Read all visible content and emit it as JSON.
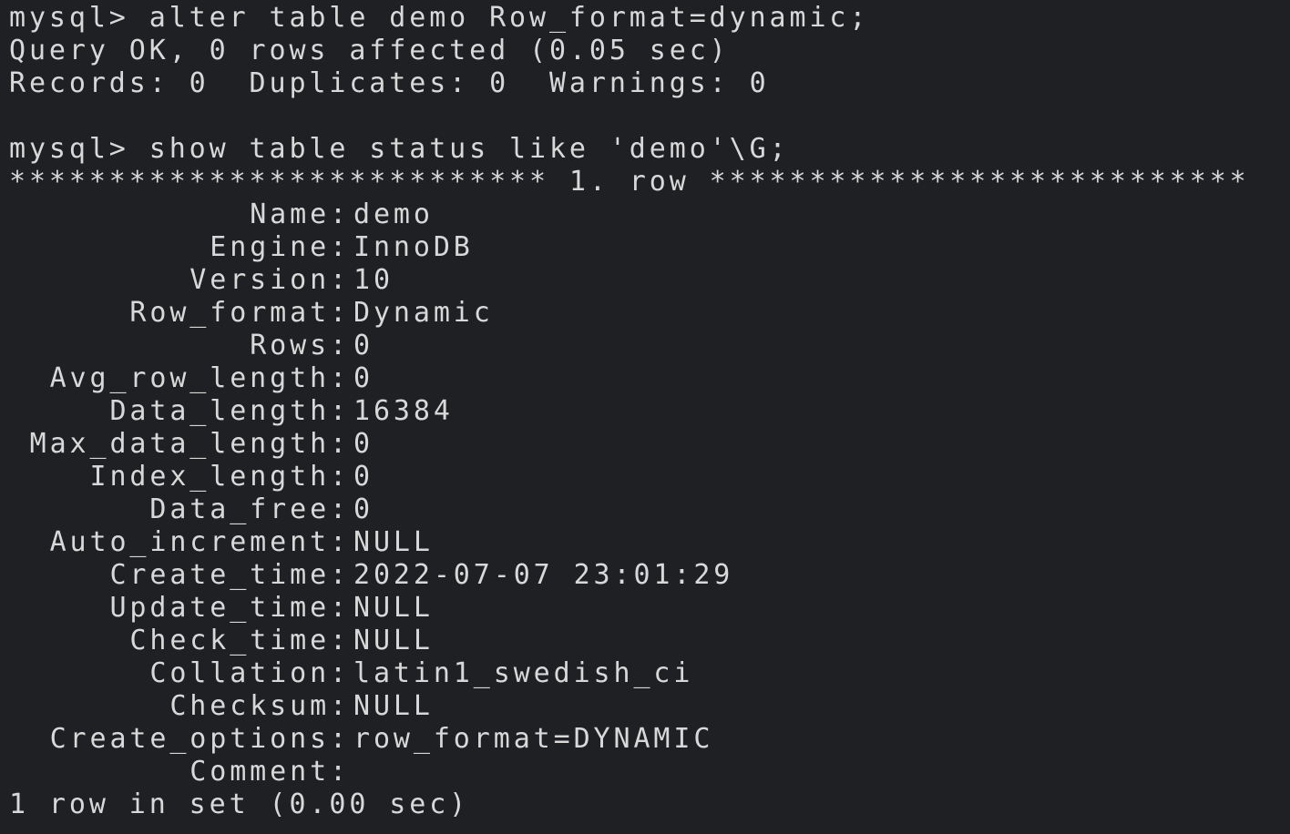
{
  "terminal": {
    "block1": {
      "command": "mysql> alter table demo Row_format=dynamic;",
      "result": "Query OK, 0 rows affected (0.05 sec)",
      "records": "Records: 0  Duplicates: 0  Warnings: 0"
    },
    "block2": {
      "command": "mysql> show table status like 'demo'\\G;",
      "row_separator": "*************************** 1. row ***************************",
      "fields": [
        {
          "label": "Name:",
          "value": "demo"
        },
        {
          "label": "Engine:",
          "value": "InnoDB"
        },
        {
          "label": "Version:",
          "value": "10"
        },
        {
          "label": "Row_format:",
          "value": "Dynamic"
        },
        {
          "label": "Rows:",
          "value": "0"
        },
        {
          "label": "Avg_row_length:",
          "value": "0"
        },
        {
          "label": "Data_length:",
          "value": "16384"
        },
        {
          "label": "Max_data_length:",
          "value": "0"
        },
        {
          "label": "Index_length:",
          "value": "0"
        },
        {
          "label": "Data_free:",
          "value": "0"
        },
        {
          "label": "Auto_increment:",
          "value": "NULL"
        },
        {
          "label": "Create_time:",
          "value": "2022-07-07 23:01:29"
        },
        {
          "label": "Update_time:",
          "value": "NULL"
        },
        {
          "label": "Check_time:",
          "value": "NULL"
        },
        {
          "label": "Collation:",
          "value": "latin1_swedish_ci"
        },
        {
          "label": "Checksum:",
          "value": "NULL"
        },
        {
          "label": "Create_options:",
          "value": "row_format=DYNAMIC"
        },
        {
          "label": "Comment:",
          "value": ""
        }
      ],
      "summary": "1 row in set (0.00 sec)"
    },
    "colors": {
      "background": "#1f2023",
      "text": "#d8d8d8"
    }
  }
}
